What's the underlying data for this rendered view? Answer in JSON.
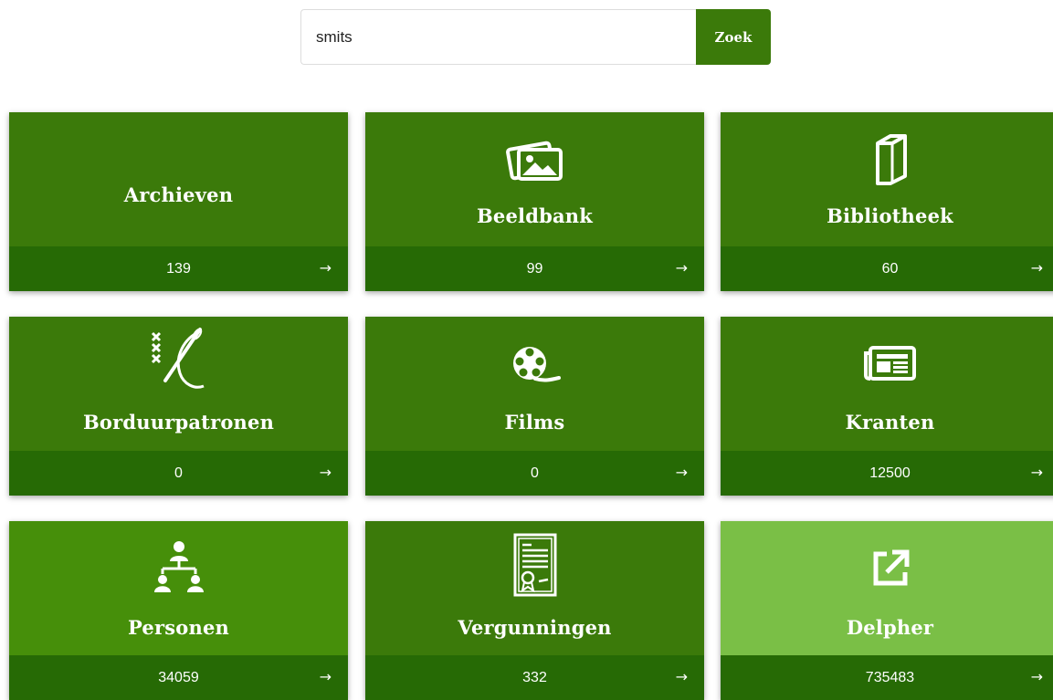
{
  "search": {
    "value": "smits",
    "button_label": "Zoek"
  },
  "tiles": [
    {
      "label": "Archieven",
      "count": "139",
      "icon": "none",
      "color": "#3b7a0a"
    },
    {
      "label": "Beeldbank",
      "count": "99",
      "icon": "photos-icon",
      "color": "#3b7a0a"
    },
    {
      "label": "Bibliotheek",
      "count": "60",
      "icon": "book-icon",
      "color": "#3b7a0a"
    },
    {
      "label": "Borduurpatronen",
      "count": "0",
      "icon": "needle-thread-icon",
      "color": "#3b7a0a"
    },
    {
      "label": "Films",
      "count": "0",
      "icon": "film-reel-icon",
      "color": "#3b7a0a"
    },
    {
      "label": "Kranten",
      "count": "12500",
      "icon": "newspaper-icon",
      "color": "#3b7a0a"
    },
    {
      "label": "Personen",
      "count": "34059",
      "icon": "family-tree-icon",
      "color": "#468f0a"
    },
    {
      "label": "Vergunningen",
      "count": "332",
      "icon": "certificate-icon",
      "color": "#3b7a0a"
    },
    {
      "label": "Delpher",
      "count": "735483",
      "icon": "external-link-icon",
      "color": "#7abf46"
    }
  ],
  "arrow_glyph": "→",
  "colors": {
    "tile_dark": "#3b7a0a",
    "tile_bar": "#266a05",
    "tile_personen": "#468f0a",
    "tile_delpher": "#7abf46"
  }
}
